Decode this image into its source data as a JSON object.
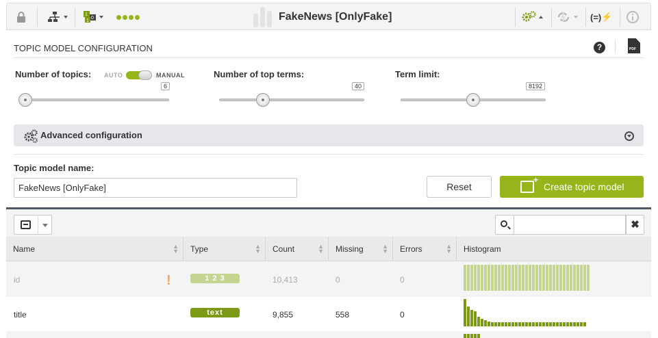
{
  "toolbar": {
    "title": "FakeNews [OnlyFake]",
    "progress_dots": 4,
    "accent": "#95b51b"
  },
  "config": {
    "section_title": "TOPIC MODEL CONFIGURATION",
    "help_icon": "?",
    "pdf_label": "PDF",
    "params": [
      {
        "label": "Number of topics:",
        "value": "6",
        "fraction": 0.03
      },
      {
        "label": "Number of top terms:",
        "value": "40",
        "fraction": 0.3
      },
      {
        "label": "Term limit:",
        "value": "8192",
        "fraction": 0.5
      }
    ],
    "toggle": {
      "off_label": "AUTO",
      "on_label": "MANUAL",
      "state": "manual"
    },
    "advanced_label": "Advanced configuration",
    "name_label": "Topic model name:",
    "name_value": "FakeNews [OnlyFake]",
    "reset_label": "Reset",
    "create_label": "Create topic model"
  },
  "fields": {
    "search_value": "",
    "columns": [
      "Name",
      "Type",
      "Count",
      "Missing",
      "Errors",
      "Histogram"
    ],
    "rows": [
      {
        "name": "id",
        "type": "1 2 3",
        "type_color": "#c4d591",
        "count": "10,413",
        "missing": "0",
        "errors": "0",
        "dimmed": true,
        "warning": "!",
        "histogram": [
          1,
          1,
          1,
          1,
          1,
          1,
          1,
          1,
          1,
          1,
          1,
          1,
          1,
          1,
          1,
          1,
          1,
          1,
          1,
          1,
          1,
          1,
          1,
          1,
          1,
          1,
          1,
          1,
          1,
          1,
          1,
          1,
          1,
          1,
          1,
          1,
          1
        ],
        "hist_color": "#c4d591"
      },
      {
        "name": "title",
        "type": "text",
        "type_color": "#7d9a16",
        "count": "9,855",
        "missing": "558",
        "errors": "0",
        "dimmed": false,
        "warning": "",
        "histogram": [
          1,
          0.72,
          0.6,
          0.55,
          0.36,
          0.28,
          0.22,
          0.18,
          0.16,
          0.16,
          0.15,
          0.15,
          0.15,
          0.15,
          0.15,
          0.15,
          0.14,
          0.14,
          0.14,
          0.14,
          0.14,
          0.14,
          0.14,
          0.14,
          0.14,
          0.14,
          0.14,
          0.14,
          0.14,
          0.14,
          0.14,
          0.14,
          0.14,
          0.14,
          0.14,
          0.14
        ],
        "hist_color": "#7d9a16"
      }
    ]
  }
}
